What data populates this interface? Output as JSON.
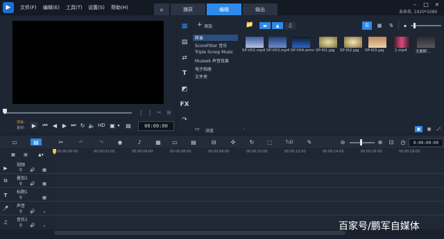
{
  "menu": [
    "文件(F)",
    "编辑(E)",
    "工具(T)",
    "设置(S)",
    "帮助(H)"
  ],
  "tabs": [
    "捕获",
    "编辑",
    "输出"
  ],
  "window": {
    "project_info": "未命名, 1920*1080"
  },
  "preview": {
    "project_label": "项目-",
    "clip_label": "素材-",
    "hd_label": "HD",
    "timecode": "00:00:00"
  },
  "library": {
    "add_label": "添加",
    "items": [
      "样本",
      "ScoreFitter 音乐",
      "Triple Scoop Music",
      "Muzeek 声音效果",
      "电子相册",
      "文件夹"
    ],
    "browse_label": "浏览",
    "thumbs": [
      "SP-V02.mp4",
      "SP-V03.mp4",
      "SP-V04.wmv",
      "SP-I01.jpg",
      "SP-I02.jpg",
      "SP-I03.jpg",
      "1.mp4",
      "无数醉..."
    ]
  },
  "timeline": {
    "timecode": "0:00:00:00",
    "tracks": [
      "视频",
      "叠加1",
      "标题1",
      "声音",
      "音乐1"
    ],
    "ruler_ticks": [
      "00:00:00:00",
      "00:00:02:00",
      "00:00:04:00",
      "00:00:06:00",
      "00:00:08:00",
      "00:00:10:00",
      "00:00:12:00",
      "00:00:14:00",
      "00:00:16:00",
      "00:00:18:00"
    ]
  },
  "watermark": "百家号/鹏军自媒体"
}
